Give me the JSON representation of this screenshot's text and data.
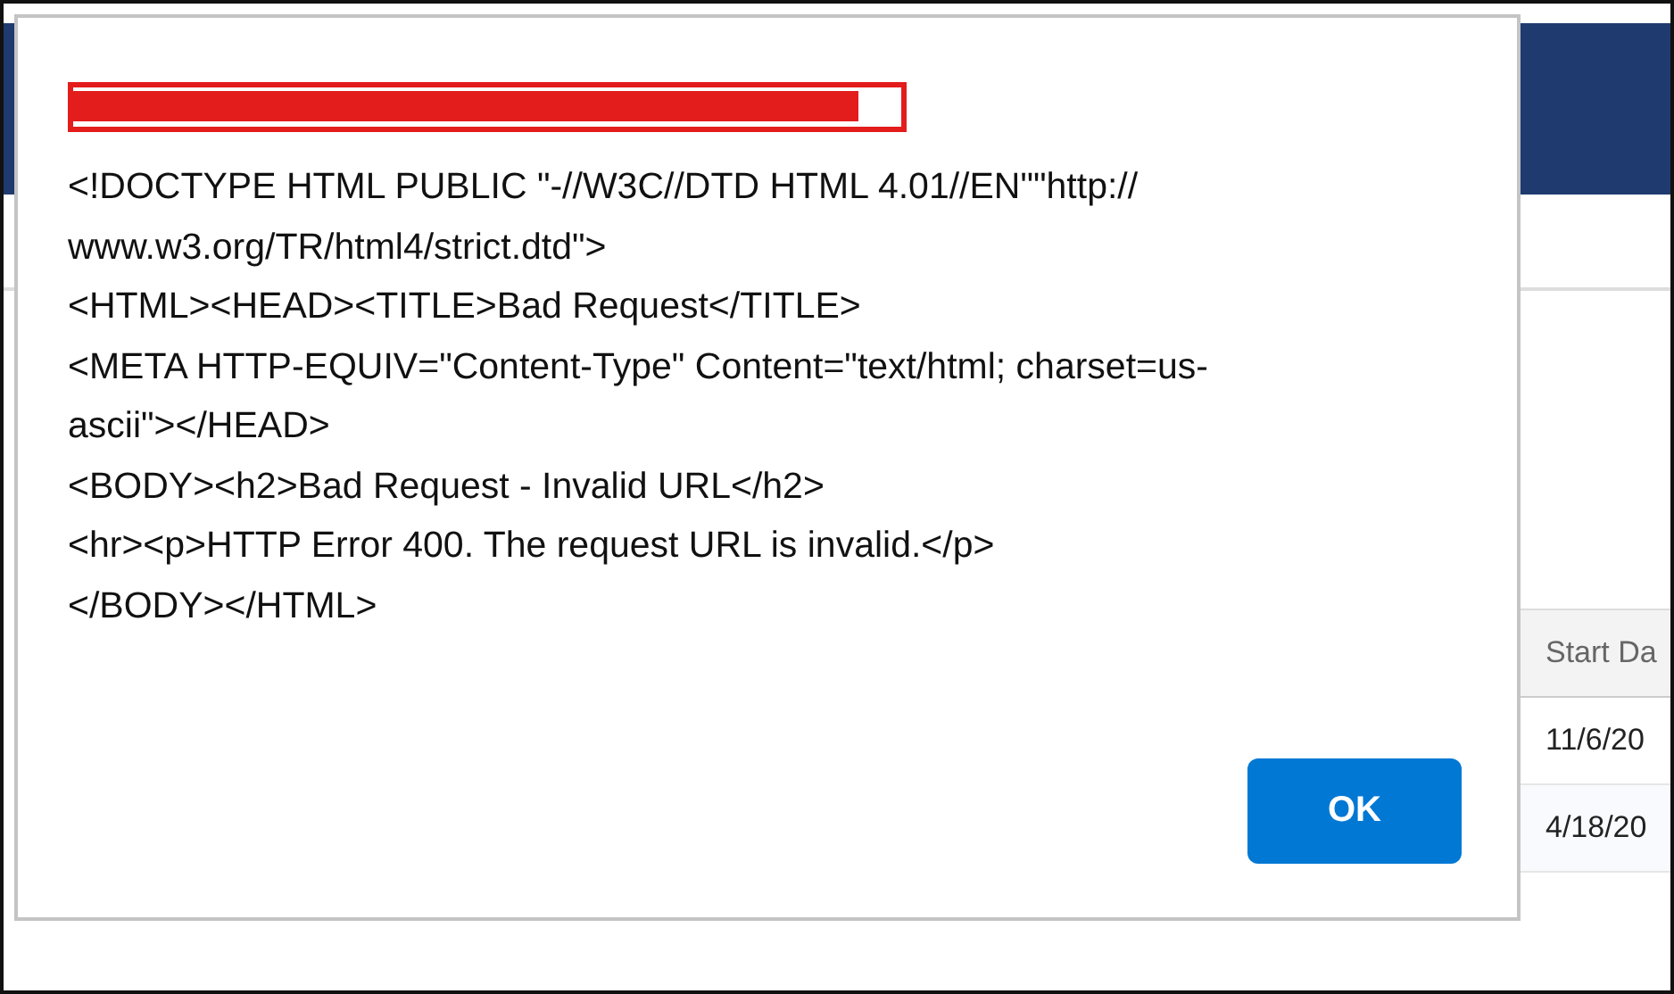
{
  "dialog": {
    "message": "<!DOCTYPE HTML PUBLIC \"-//W3C//DTD HTML 4.01//EN\"\"http://\nwww.w3.org/TR/html4/strict.dtd\">\n<HTML><HEAD><TITLE>Bad Request</TITLE>\n<META HTTP-EQUIV=\"Content-Type\" Content=\"text/html; charset=us-\nascii\"></HEAD>\n<BODY><h2>Bad Request - Invalid URL</h2>\n<hr><p>HTTP Error 400. The request URL is invalid.</p>\n</BODY></HTML>",
    "buttons": [
      "OK"
    ]
  },
  "table": {
    "columns": [
      "Start Da"
    ],
    "rows": [
      [
        "11/6/20"
      ],
      [
        "4/18/20"
      ]
    ]
  }
}
